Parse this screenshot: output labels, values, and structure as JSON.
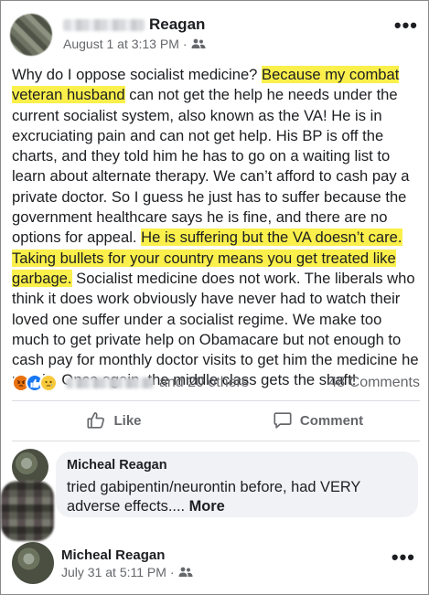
{
  "post": {
    "author_visible": "Reagan",
    "date": "August 1 at 3:13 PM",
    "separator": "·",
    "more": "•••",
    "body_segments": [
      {
        "text": "Why do I oppose socialist medicine? ",
        "highlight": false
      },
      {
        "text": "Because my combat veteran husband",
        "highlight": true
      },
      {
        "text": " can not get the help he needs under the current socialist system, also known as the VA! He is in excruciating pain and can not get help. His BP is off the charts, and they told him he has to go on a waiting list to learn about alternate therapy. We can’t afford to cash pay a private doctor. So I guess he just has to suffer because the government healthcare says he is fine, and there are no options for appeal. ",
        "highlight": false
      },
      {
        "text": "He is suffering but the VA doesn’t care. Taking bullets for your country means you get treated like garbage.",
        "highlight": true
      },
      {
        "text": " Socialist medicine does not work. The liberals who think it does work obviously have never had to watch their loved one suffer under a socialist regime. We make too much to get private help on Obamacare but not enough to cash pay for monthly doctor visits to get him the medicine he needs. Once again, the middle class gets the shaft!",
        "highlight": false
      }
    ]
  },
  "reactions": {
    "others_text": "and 20 others",
    "comments_count": "48 Comments",
    "icons": [
      "angry-react-icon",
      "like-react-icon",
      "sad-react-icon"
    ]
  },
  "actions": {
    "like_label": "Like",
    "comment_label": "Comment"
  },
  "comment": {
    "author": "Micheal Reagan",
    "text_main": "tried gabipentin/neurontin before, had VERY adverse effects.... ",
    "more_label": "More"
  },
  "next_post": {
    "author": "Micheal Reagan",
    "date": "July 31 at 5:11 PM",
    "separator": "·",
    "more": "•••"
  },
  "colors": {
    "highlight": "#fbf04b",
    "secondary_text": "#65676b",
    "bubble_bg": "#f0f2f5"
  }
}
